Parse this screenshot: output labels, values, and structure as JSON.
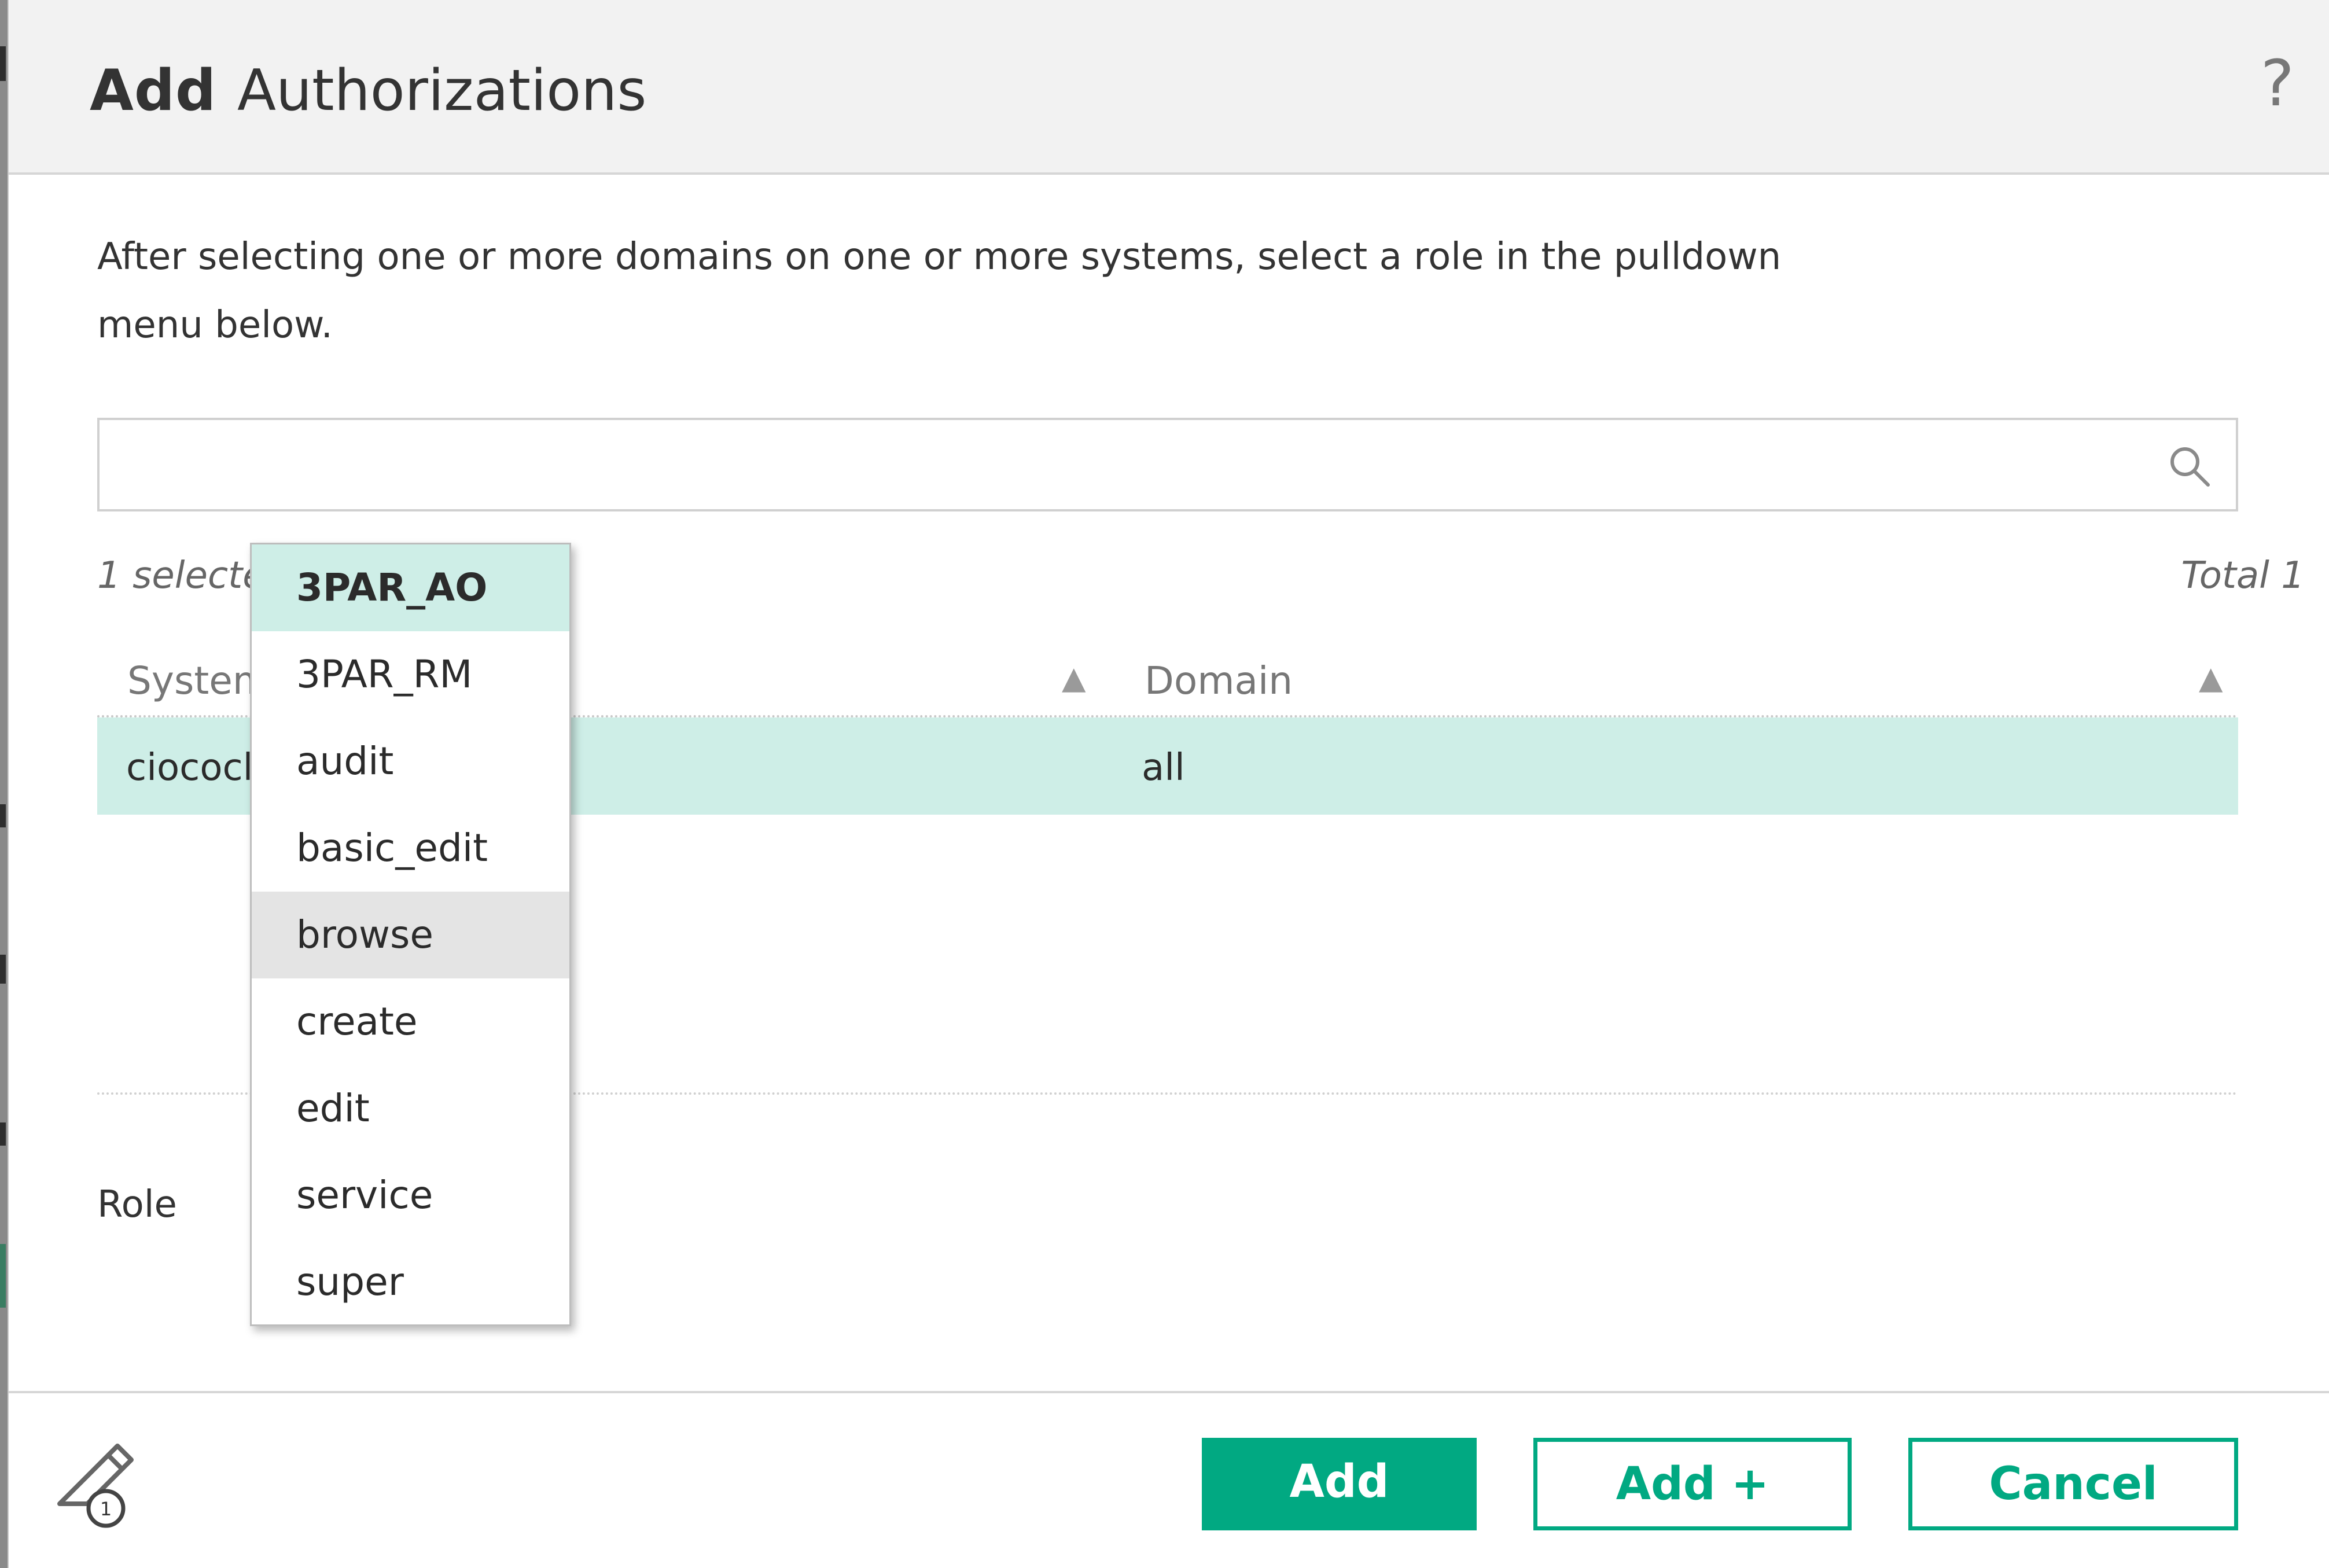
{
  "dialog": {
    "title_bold": "Add",
    "title_rest": "Authorizations",
    "help_label": "?",
    "instructions": "After selecting one or more domains on one or more systems, select a role in the pulldown menu below."
  },
  "search": {
    "placeholder": "",
    "icon": "search-icon"
  },
  "table": {
    "selected_count": "1 selected",
    "total_count": "Total 1",
    "columns": [
      "System",
      "Domain"
    ],
    "rows": [
      {
        "system": "ciococl",
        "domain": "all",
        "selected": true
      }
    ]
  },
  "role": {
    "label": "Role",
    "options": [
      "3PAR_AO",
      "3PAR_RM",
      "audit",
      "basic_edit",
      "browse",
      "create",
      "edit",
      "service",
      "super"
    ],
    "highlighted": "3PAR_AO",
    "hovered": "browse"
  },
  "footer": {
    "notes_icon": "notes-icon",
    "notes_badge": "1",
    "buttons": {
      "add": "Add",
      "add_plus": "Add +",
      "cancel": "Cancel"
    }
  },
  "colors": {
    "accent": "#01a982",
    "selection": "#ceeee7",
    "hover": "#e4e4e4"
  }
}
